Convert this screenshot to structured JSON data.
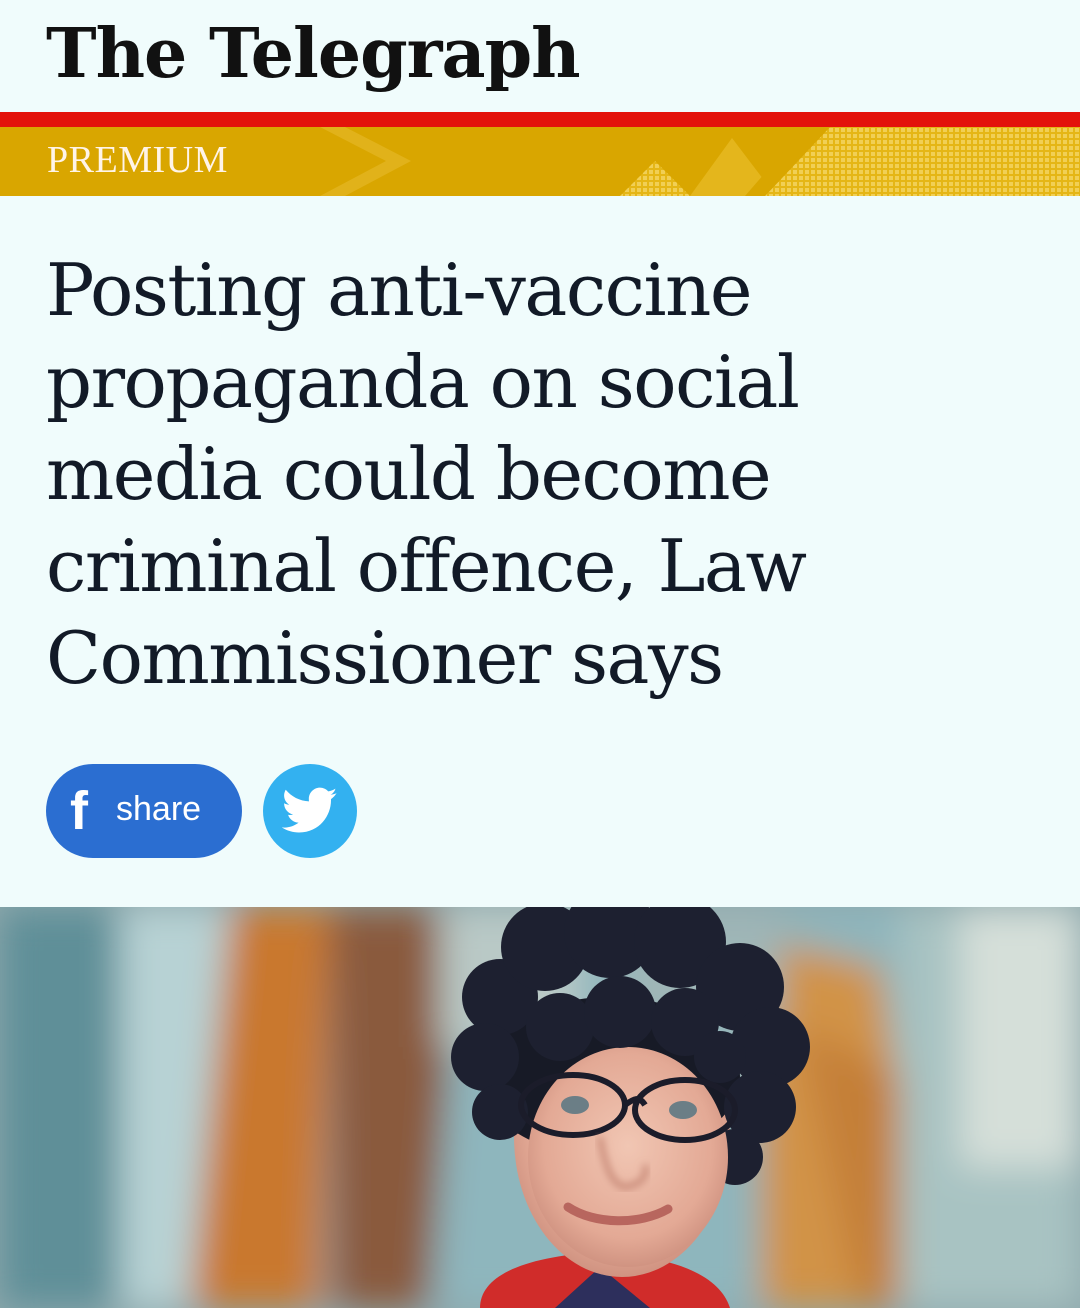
{
  "masthead": {
    "logo_text": "The Telegraph"
  },
  "section_band": {
    "label": "PREMIUM",
    "colors": {
      "rule": "#e3120b",
      "band": "#d9a600",
      "label": "#fff4e8"
    }
  },
  "article": {
    "headline": "Posting anti-vaccine propaganda on social media could become criminal offence, Law Commissioner says"
  },
  "share": {
    "facebook": {
      "icon": "facebook-f-icon",
      "label": "share",
      "color": "#2b6ed1"
    },
    "twitter": {
      "icon": "twitter-bird-icon",
      "color": "#33b1f0"
    }
  },
  "photo": {
    "subject": "portrait of woman with dark curly hair and glasses"
  }
}
